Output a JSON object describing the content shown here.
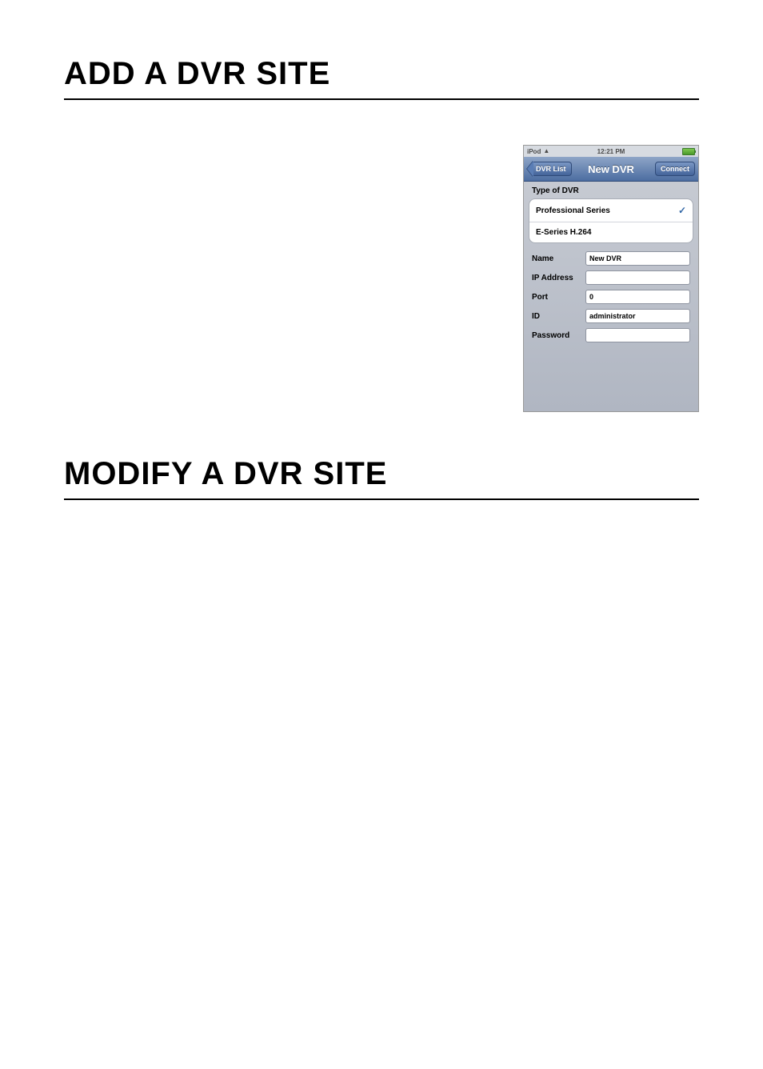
{
  "sections": {
    "add_title": "ADD A DVR SITE",
    "modify_title": "MODIFY A DVR SITE"
  },
  "phone": {
    "statusbar": {
      "device": "iPod",
      "time": "12:21 PM"
    },
    "navbar": {
      "back_label": "DVR List",
      "title": "New DVR",
      "right_label": "Connect"
    },
    "type_group": {
      "header": "Type of DVR",
      "options": [
        {
          "label": "Professional Series",
          "selected": true
        },
        {
          "label": "E-Series H.264",
          "selected": false
        }
      ]
    },
    "form": {
      "rows": [
        {
          "label": "Name",
          "value": "New DVR"
        },
        {
          "label": "IP Address",
          "value": ""
        },
        {
          "label": "Port",
          "value": "0"
        },
        {
          "label": "ID",
          "value": "administrator"
        },
        {
          "label": "Password",
          "value": ""
        }
      ]
    }
  }
}
